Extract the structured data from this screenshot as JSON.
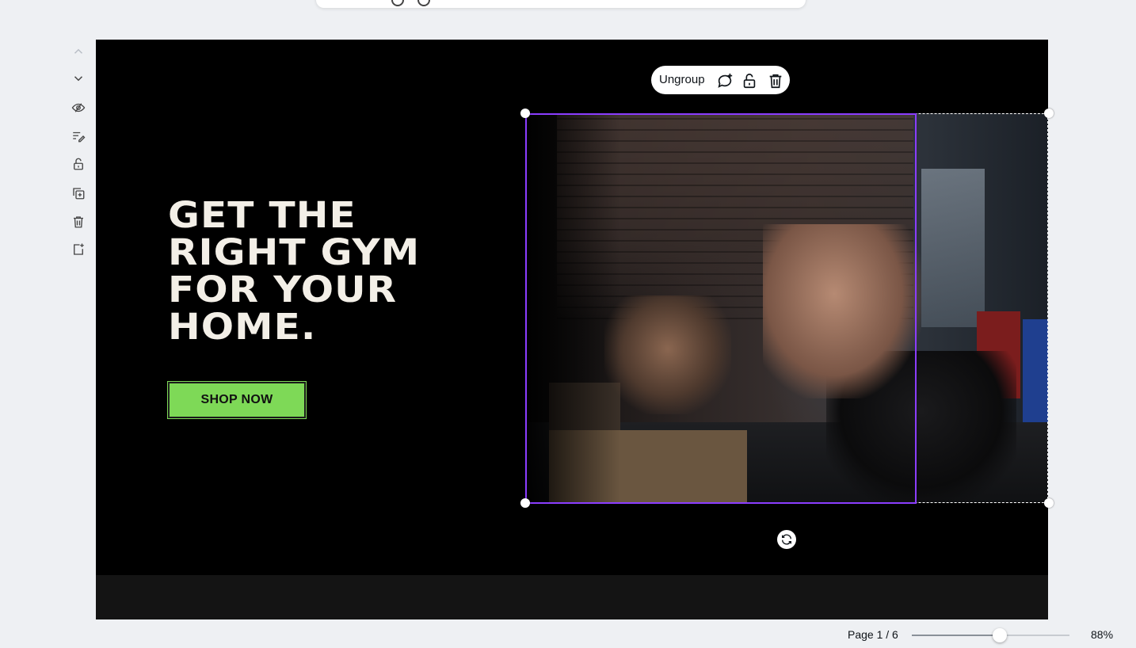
{
  "toolbar_left": {
    "items": [
      "chevron-up",
      "chevron-down",
      "hide-eye",
      "notes",
      "lock",
      "duplicate",
      "delete",
      "add-page"
    ]
  },
  "design": {
    "headline": "GET THE\nRIGHT GYM\nFOR YOUR\nHOME.",
    "cta_label": "SHOP NOW",
    "cta_color": "#7ed957",
    "background_color": "#000000",
    "headline_color": "#f3efe7"
  },
  "selection": {
    "accent_color": "#8b3dff"
  },
  "context_toolbar": {
    "ungroup_label": "Ungroup",
    "icons": [
      "comment-add-icon",
      "lock-icon",
      "trash-icon"
    ]
  },
  "footer": {
    "page_indicator": "Page 1 / 6",
    "zoom_value": 0.56,
    "zoom_label": "88%"
  }
}
